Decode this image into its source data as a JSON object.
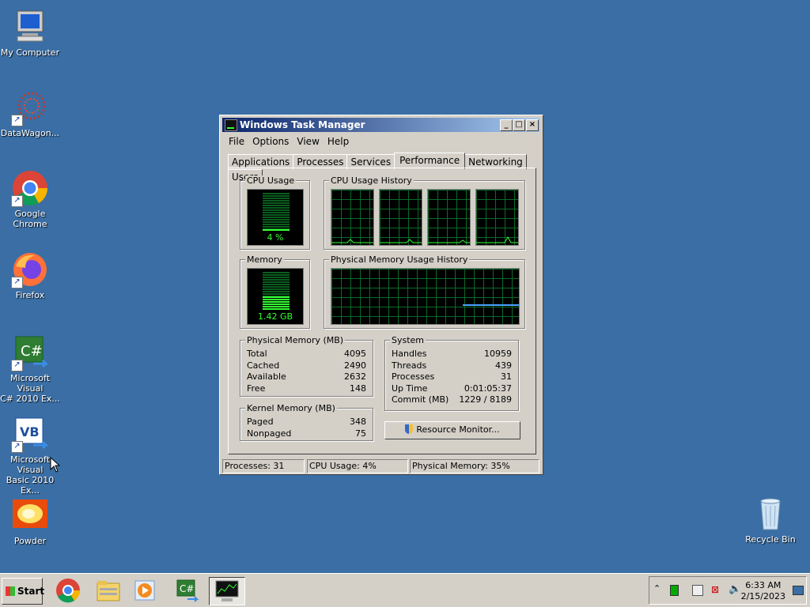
{
  "desktop": {
    "icons": [
      {
        "label": "My Computer"
      },
      {
        "label": "DataWagon..."
      },
      {
        "label": "Google Chrome"
      },
      {
        "label": "Firefox"
      },
      {
        "label_line1": "Microsoft Visual",
        "label_line2": "C# 2010 Ex..."
      },
      {
        "label_line1": "Microsoft Visual",
        "label_line2": "Basic 2010 Ex..."
      },
      {
        "label": "Powder"
      },
      {
        "label": "Recycle Bin"
      }
    ]
  },
  "window": {
    "title": "Windows Task Manager",
    "controls": {
      "minimize": "_",
      "maximize": "□",
      "close": "×"
    },
    "menu": [
      "File",
      "Options",
      "View",
      "Help"
    ],
    "tabs": [
      "Applications",
      "Processes",
      "Services",
      "Performance",
      "Networking",
      "Users"
    ],
    "active_tab": "Performance",
    "cpu_usage": {
      "label": "CPU Usage",
      "value_text": "4 %",
      "level": 0.04
    },
    "cpu_history": {
      "label": "CPU Usage History"
    },
    "memory": {
      "label": "Memory",
      "value_text": "1.42 GB",
      "level": 0.35
    },
    "mem_history": {
      "label": "Physical Memory Usage History"
    },
    "physical_memory": {
      "label": "Physical Memory (MB)",
      "rows": [
        {
          "k": "Total",
          "v": "4095"
        },
        {
          "k": "Cached",
          "v": "2490"
        },
        {
          "k": "Available",
          "v": "2632"
        },
        {
          "k": "Free",
          "v": "148"
        }
      ]
    },
    "system": {
      "label": "System",
      "rows": [
        {
          "k": "Handles",
          "v": "10959"
        },
        {
          "k": "Threads",
          "v": "439"
        },
        {
          "k": "Processes",
          "v": "31"
        },
        {
          "k": "Up Time",
          "v": "0:01:05:37"
        },
        {
          "k": "Commit (MB)",
          "v": "1229 / 8189"
        }
      ]
    },
    "kernel_memory": {
      "label": "Kernel Memory (MB)",
      "rows": [
        {
          "k": "Paged",
          "v": "348"
        },
        {
          "k": "Nonpaged",
          "v": "75"
        }
      ]
    },
    "resource_monitor_button": "Resource Monitor...",
    "status": {
      "processes": "Processes: 31",
      "cpu": "CPU Usage: 4%",
      "memory": "Physical Memory: 35%"
    }
  },
  "taskbar": {
    "start_label": "Start",
    "apps": [
      "chrome-icon",
      "explorer-icon",
      "media-player-icon",
      "visual-csharp-icon",
      "task-manager-icon"
    ],
    "clock_time": "6:33 AM",
    "clock_date": "2/15/2023"
  },
  "colors": {
    "desktop": "#3a6ea5",
    "title_start": "#0a246a",
    "title_end": "#a6caf0",
    "meter_green": "#33ff33"
  }
}
